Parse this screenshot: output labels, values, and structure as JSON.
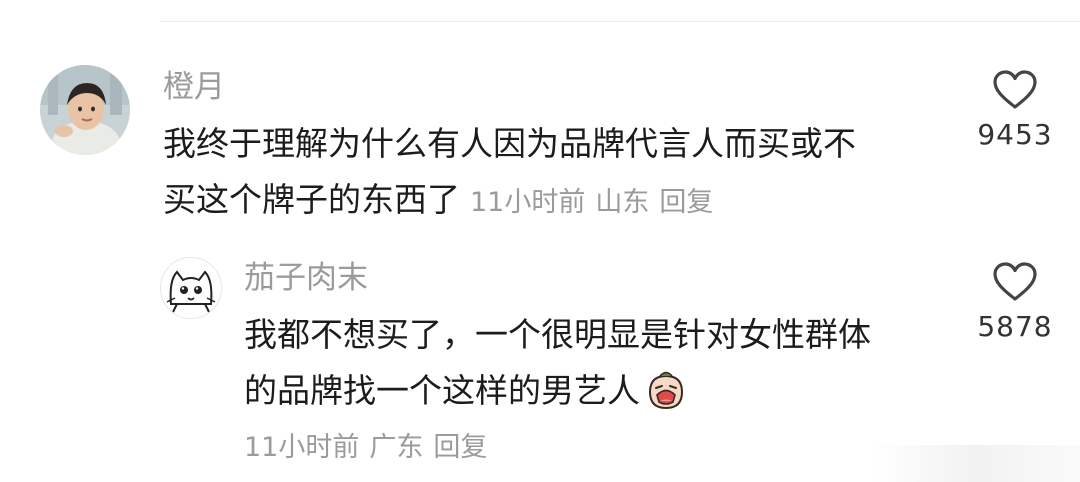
{
  "comments": [
    {
      "avatar_icon": "child-photo-avatar",
      "username": "橙月",
      "text_line1": "我终于理解为什么有人因为品牌代言人而买或不",
      "text_line2": "买这个牌子的东西了",
      "time": "11小时前",
      "location": "山东",
      "reply_label": "回复",
      "like_icon": "heart-outline-icon",
      "like_count": "9453"
    },
    {
      "avatar_icon": "cartoon-cat-avatar",
      "username": "茄子肉末",
      "text_line1": "我都不想买了，一个很明显是针对女性群体",
      "text_line2": "的品牌找一个这样的男艺人",
      "emoji_icon": "crying-face-emoji",
      "time": "11小时前",
      "location": "广东",
      "reply_label": "回复",
      "like_icon": "heart-outline-icon",
      "like_count": "5878"
    }
  ],
  "colors": {
    "username": "#9b9b9b",
    "text": "#1c1c1c",
    "meta": "#9b9b9b",
    "like_count": "#333333",
    "heart_stroke": "#444444"
  }
}
